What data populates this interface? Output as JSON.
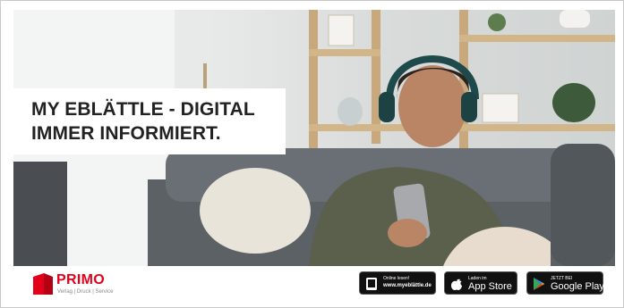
{
  "ad": {
    "headline_line1": "MY EBLÄTTLE - DIGITAL",
    "headline_line2": "IMMER INFORMIERT."
  },
  "brand": {
    "name": "PRIMO",
    "tagline": "Verlag | Druck | Service",
    "color": "#e3001b"
  },
  "badges": {
    "web": {
      "small": "Online lesen!",
      "url": "www.myeblättle.de",
      "icon": "tablet-icon"
    },
    "apple": {
      "small": "Laden im",
      "label": "App Store",
      "icon": "apple-icon"
    },
    "google": {
      "small": "JETZT BEI",
      "label": "Google Play",
      "icon": "google-play-icon"
    }
  },
  "photo": {
    "subject": "woman-with-headphones-on-sofa-photo"
  }
}
